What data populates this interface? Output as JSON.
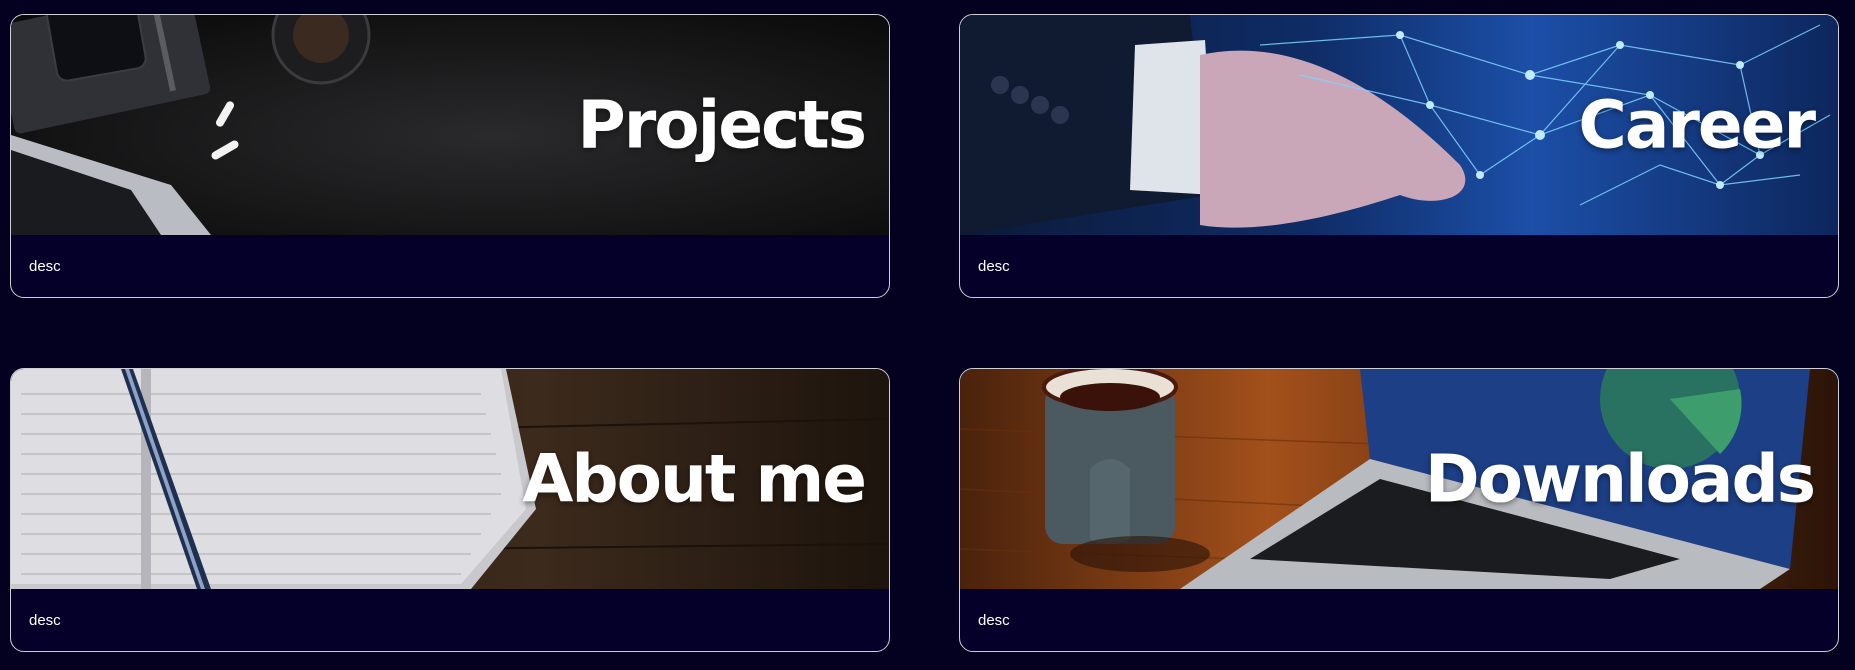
{
  "cards": [
    {
      "title": "Projects",
      "desc": "desc"
    },
    {
      "title": "Career",
      "desc": "desc"
    },
    {
      "title": "About me",
      "desc": "desc"
    },
    {
      "title": "Downloads",
      "desc": "desc"
    }
  ],
  "colors": {
    "page_background": "#04001f",
    "card_background": "#05002a",
    "card_border": "#cfcfd6",
    "title_text": "#ffffff"
  }
}
